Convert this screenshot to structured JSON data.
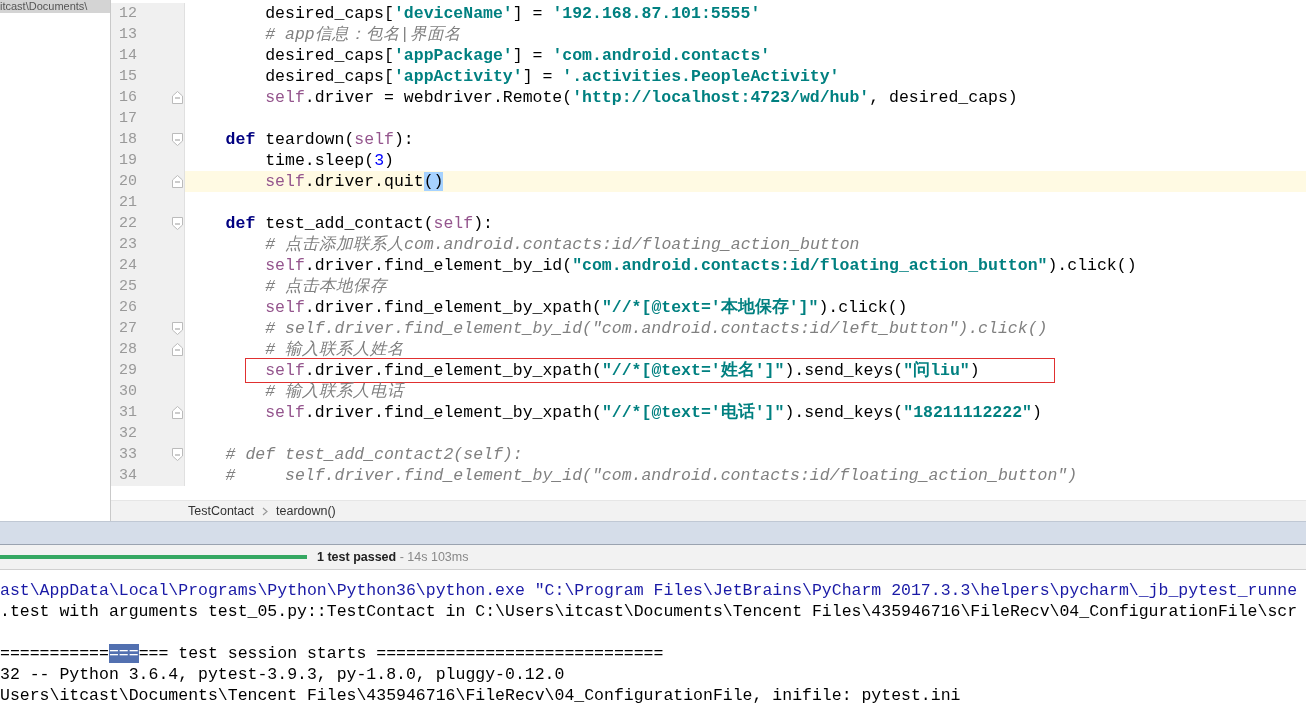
{
  "project_panel": {
    "tab_title": "itcast\\Documents\\"
  },
  "editor": {
    "lines": [
      {
        "number": "12",
        "kind": "body",
        "tokens": [
          {
            "text": "desired_caps[",
            "kind": "plain"
          },
          {
            "text": "'deviceName'",
            "kind": "string"
          },
          {
            "text": "] = ",
            "kind": "plain"
          },
          {
            "text": "'192.168.87.101:5555'",
            "kind": "string"
          }
        ]
      },
      {
        "number": "13",
        "kind": "body",
        "tokens": [
          {
            "text": "# app信息：包名|界面名",
            "kind": "comment"
          }
        ]
      },
      {
        "number": "14",
        "kind": "body",
        "tokens": [
          {
            "text": "desired_caps[",
            "kind": "plain"
          },
          {
            "text": "'appPackage'",
            "kind": "string"
          },
          {
            "text": "] = ",
            "kind": "plain"
          },
          {
            "text": "'com.android.contacts'",
            "kind": "string"
          }
        ]
      },
      {
        "number": "15",
        "kind": "body",
        "tokens": [
          {
            "text": "desired_caps[",
            "kind": "plain"
          },
          {
            "text": "'appActivity'",
            "kind": "string"
          },
          {
            "text": "] = ",
            "kind": "plain"
          },
          {
            "text": "'.activities.PeopleActivity'",
            "kind": "string"
          }
        ]
      },
      {
        "number": "16",
        "kind": "body",
        "fold_end": true,
        "tokens": [
          {
            "text": "self",
            "kind": "self"
          },
          {
            "text": ".driver = webdriver.Remote(",
            "kind": "plain"
          },
          {
            "text": "'http://localhost:4723/wd/hub'",
            "kind": "string"
          },
          {
            "text": ", desired_caps)",
            "kind": "plain"
          }
        ]
      },
      {
        "number": "17"
      },
      {
        "number": "18",
        "kind": "def",
        "fold_start": true,
        "tokens": [
          {
            "text": "def",
            "kind": "keyword"
          },
          {
            "text": " teardown(",
            "kind": "plain"
          },
          {
            "text": "self",
            "kind": "self"
          },
          {
            "text": "):",
            "kind": "plain"
          }
        ]
      },
      {
        "number": "19",
        "kind": "body",
        "tokens": [
          {
            "text": "time.sleep(",
            "kind": "plain"
          },
          {
            "text": "3",
            "kind": "number"
          },
          {
            "text": ")",
            "kind": "plain"
          }
        ]
      },
      {
        "number": "20",
        "kind": "body",
        "fold_end": true,
        "current": true,
        "tokens": [
          {
            "text": "self",
            "kind": "self"
          },
          {
            "text": ".driver.quit",
            "kind": "plain"
          },
          {
            "text": "()",
            "kind": "plain",
            "selected": true
          }
        ]
      },
      {
        "number": "21"
      },
      {
        "number": "22",
        "kind": "def",
        "fold_start": true,
        "tokens": [
          {
            "text": "def",
            "kind": "keyword"
          },
          {
            "text": " test_add_contact(",
            "kind": "plain"
          },
          {
            "text": "self",
            "kind": "self"
          },
          {
            "text": "):",
            "kind": "plain"
          }
        ]
      },
      {
        "number": "23",
        "kind": "body",
        "tokens": [
          {
            "text": "# 点击添加联系人com.android.contacts:id/floating_action_button",
            "kind": "comment"
          }
        ]
      },
      {
        "number": "24",
        "kind": "body",
        "tokens": [
          {
            "text": "self",
            "kind": "self"
          },
          {
            "text": ".driver.find_element_by_id(",
            "kind": "plain"
          },
          {
            "text": "\"com.android.contacts:id/floating_action_button\"",
            "kind": "string"
          },
          {
            "text": ").click()",
            "kind": "plain"
          }
        ]
      },
      {
        "number": "25",
        "kind": "body",
        "tokens": [
          {
            "text": "# 点击本地保存",
            "kind": "comment"
          }
        ]
      },
      {
        "number": "26",
        "kind": "body",
        "tokens": [
          {
            "text": "self",
            "kind": "self"
          },
          {
            "text": ".driver.find_element_by_xpath(",
            "kind": "plain"
          },
          {
            "text": "\"//*[@text='本地保存']\"",
            "kind": "string"
          },
          {
            "text": ").click()",
            "kind": "plain"
          }
        ]
      },
      {
        "number": "27",
        "kind": "body",
        "fold_start": true,
        "tokens": [
          {
            "text": "# self.driver.find_element_by_id(\"com.android.contacts:id/left_button\").click()",
            "kind": "comment"
          }
        ]
      },
      {
        "number": "28",
        "kind": "body",
        "fold_end": true,
        "tokens": [
          {
            "text": "# 输入联系人姓名",
            "kind": "comment"
          }
        ]
      },
      {
        "number": "29",
        "kind": "body",
        "boxed": true,
        "tokens": [
          {
            "text": "self",
            "kind": "self"
          },
          {
            "text": ".driver.find_element_by_xpath(",
            "kind": "plain"
          },
          {
            "text": "\"//*[@text='姓名']\"",
            "kind": "string"
          },
          {
            "text": ").send_keys(",
            "kind": "plain"
          },
          {
            "text": "\"问liu\"",
            "kind": "string"
          },
          {
            "text": ")",
            "kind": "plain"
          }
        ]
      },
      {
        "number": "30",
        "kind": "body",
        "tokens": [
          {
            "text": "# 输入联系人电话",
            "kind": "comment"
          }
        ]
      },
      {
        "number": "31",
        "kind": "body",
        "fold_end": true,
        "tokens": [
          {
            "text": "self",
            "kind": "self"
          },
          {
            "text": ".driver.find_element_by_xpath(",
            "kind": "plain"
          },
          {
            "text": "\"//*[@text='电话']\"",
            "kind": "string"
          },
          {
            "text": ").send_keys(",
            "kind": "plain"
          },
          {
            "text": "\"18211112222\"",
            "kind": "string"
          },
          {
            "text": ")",
            "kind": "plain"
          }
        ]
      },
      {
        "number": "32"
      },
      {
        "number": "33",
        "kind": "def",
        "fold_start": true,
        "tokens": [
          {
            "text": "# def test_add_contact2(self):",
            "kind": "comment"
          }
        ]
      },
      {
        "number": "34",
        "kind": "def",
        "tokens": [
          {
            "text": "#     self.driver.find_element_by_id(\"com.android.contacts:id/floating_action_button\")",
            "kind": "comment"
          }
        ]
      }
    ]
  },
  "breadcrumb": [
    "TestContact",
    "teardown()"
  ],
  "test_status": {
    "level": 1,
    "result": "1 test passed",
    "duration": " - 14s 103ms"
  },
  "console": [
    {
      "kind": "command",
      "segments": [
        {
          "text": "ast\\AppData\\Local\\Programs\\Python\\Python36\\python.exe \"C:\\Program Files\\JetBrains\\PyCharm 2017.3.3\\helpers\\pycharm\\_jb_pytest_runne"
        }
      ]
    },
    {
      "kind": "output",
      "segments": [
        {
          "text": ".test with arguments test_05.py::TestContact in C:\\Users\\itcast\\Documents\\Tencent Files\\435946716\\FileRecv\\04_ConfigurationFile\\scr"
        }
      ]
    },
    {
      "kind": "blank"
    },
    {
      "kind": "output",
      "segments": [
        {
          "text": "==========="
        },
        {
          "text": "===",
          "selected": true
        },
        {
          "text": "=== test session starts ============================="
        }
      ]
    },
    {
      "kind": "output",
      "segments": [
        {
          "text": "32 -- Python 3.6.4, pytest-3.9.3, py-1.8.0, pluggy-0.12.0"
        }
      ]
    },
    {
      "kind": "output",
      "segments": [
        {
          "text": "Users\\itcast\\Documents\\Tencent Files\\435946716\\FileRecv\\04_ConfigurationFile, inifile: pytest.ini"
        }
      ]
    }
  ]
}
